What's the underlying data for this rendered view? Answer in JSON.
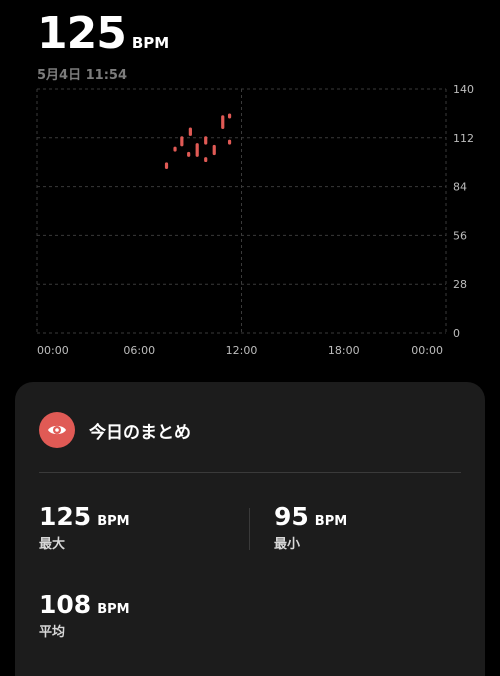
{
  "header": {
    "value": "125",
    "unit": "BPM",
    "timestamp": "5月4日 11:54"
  },
  "chart_data": {
    "type": "scatter",
    "ylim": [
      0,
      140
    ],
    "y_ticks": [
      "140",
      "112",
      "84",
      "56",
      "28",
      "0"
    ],
    "x_ticks": [
      "00:00",
      "06:00",
      "12:00",
      "18:00",
      "00:00"
    ],
    "grid": true,
    "color": "#e05a55",
    "points": [
      {
        "time": 7.6,
        "low": 95,
        "high": 97
      },
      {
        "time": 8.1,
        "low": 105,
        "high": 106
      },
      {
        "time": 8.5,
        "low": 108,
        "high": 112
      },
      {
        "time": 8.9,
        "low": 102,
        "high": 103
      },
      {
        "time": 9.0,
        "low": 114,
        "high": 117
      },
      {
        "time": 9.4,
        "low": 102,
        "high": 108
      },
      {
        "time": 9.9,
        "low": 99,
        "high": 100
      },
      {
        "time": 9.9,
        "low": 109,
        "high": 112
      },
      {
        "time": 10.4,
        "low": 103,
        "high": 107
      },
      {
        "time": 10.9,
        "low": 118,
        "high": 124
      },
      {
        "time": 11.3,
        "low": 109,
        "high": 110
      },
      {
        "time": 11.3,
        "low": 124,
        "high": 125
      }
    ]
  },
  "summary": {
    "title": "今日のまとめ",
    "max": {
      "value": "125",
      "unit": "BPM",
      "label": "最大"
    },
    "min": {
      "value": "95",
      "unit": "BPM",
      "label": "最小"
    },
    "avg": {
      "value": "108",
      "unit": "BPM",
      "label": "平均"
    }
  }
}
